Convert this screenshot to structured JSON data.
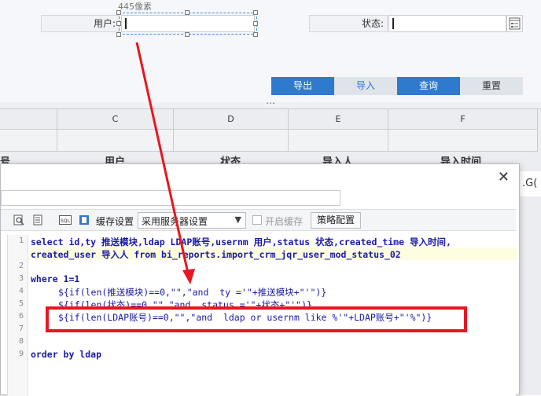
{
  "form": {
    "width_hint": "445像素",
    "user_label": "用户:",
    "status_label": "状态:"
  },
  "buttons": {
    "export": "导出",
    "import": "导入",
    "query": "查询",
    "reset": "重置"
  },
  "splitter_dots": "⋯",
  "sheet": {
    "columns": [
      "C",
      "D",
      "E",
      "F"
    ],
    "headers": {
      "cut_left": "号",
      "user": "用户",
      "status": "状态",
      "importer": "导入人",
      "import_time": "导入时间"
    },
    "right_fragment": ".G("
  },
  "dialog": {
    "close_label": "✕",
    "cache_label": "缓存设置",
    "cache_select_value": "采用服务器设置",
    "enable_cache_label": "开启缓存",
    "strategy_button": "策略配置"
  },
  "sql_lines": [
    {
      "num": "1",
      "text": "select id,ty 推送模块,ldap LDAP账号,usernm 用户,status 状态,created_time 导入时间,"
    },
    {
      "num": "",
      "text": "created_user 导入人 from bi_reports.import_crm_jqr_user_mod_status_02"
    },
    {
      "num": "2",
      "text": ""
    },
    {
      "num": "3",
      "text": "where 1=1"
    },
    {
      "num": "4",
      "text": "${if(len(推送模块)==0,\"\",\"and  ty ='\"+推送模块+\"'\")}"
    },
    {
      "num": "5",
      "text": "${if(len(状态)==0,\"\",\"and  status ='\"+状态+\"'\")}"
    },
    {
      "num": "6",
      "text": "${if(len(LDAP账号)==0,\"\",\"and  ldap or usernm like %'\"+LDAP账号+\"'%\")}"
    },
    {
      "num": "7",
      "text": ""
    },
    {
      "num": "8",
      "text": ""
    },
    {
      "num": "9",
      "text": "order by ldap"
    }
  ],
  "colors": {
    "button_blue": "#2f79cf",
    "button_gray": "#dfe3ea",
    "annotation_red": "#e8161f",
    "keyword_blue": "#1a1aa6",
    "string_red": "#a31515"
  }
}
